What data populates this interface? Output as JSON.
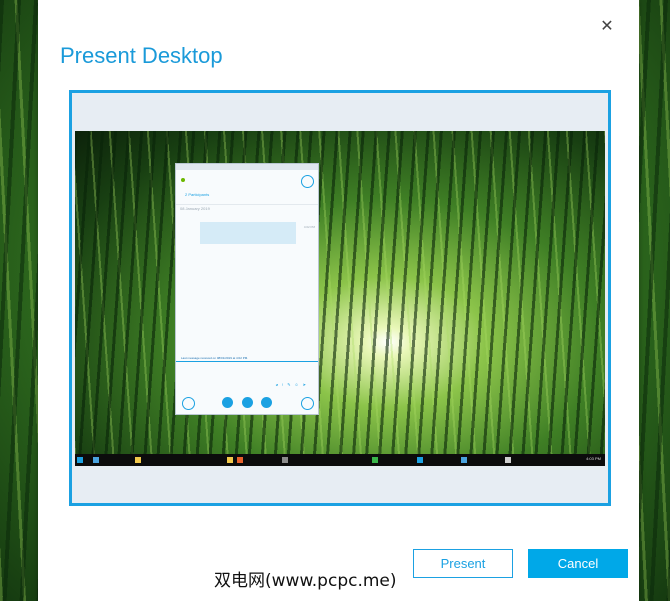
{
  "dialog": {
    "title": "Present Desktop",
    "close_symbol": "✕"
  },
  "preview": {
    "chat": {
      "participants": "2 Participants",
      "date": "08 January 2019",
      "message_time": "4:02 PM",
      "last_message": "Last message received on 08/01/2019 at 4:02 PM."
    },
    "taskbar_time": "4:03 PM"
  },
  "buttons": {
    "present": "Present",
    "cancel": "Cancel"
  },
  "watermark": "双电网(www.pcpc.me)",
  "colors": {
    "accent": "#1ba1e2",
    "cancel_bg": "#00a8e8"
  }
}
